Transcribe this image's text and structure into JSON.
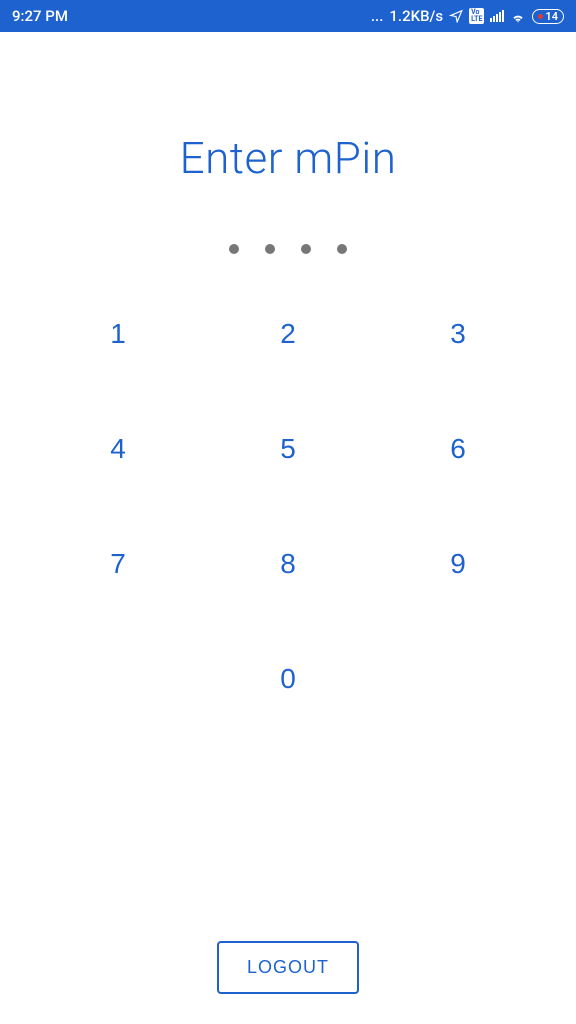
{
  "status": {
    "time": "9:27 PM",
    "dataRate": "1.2KB/s",
    "battery": "14",
    "volte": "Vo LTE"
  },
  "title": "Enter mPin",
  "keypad": {
    "k1": "1",
    "k2": "2",
    "k3": "3",
    "k4": "4",
    "k5": "5",
    "k6": "6",
    "k7": "7",
    "k8": "8",
    "k9": "9",
    "k0": "0"
  },
  "buttons": {
    "logout": "LOGOUT"
  }
}
